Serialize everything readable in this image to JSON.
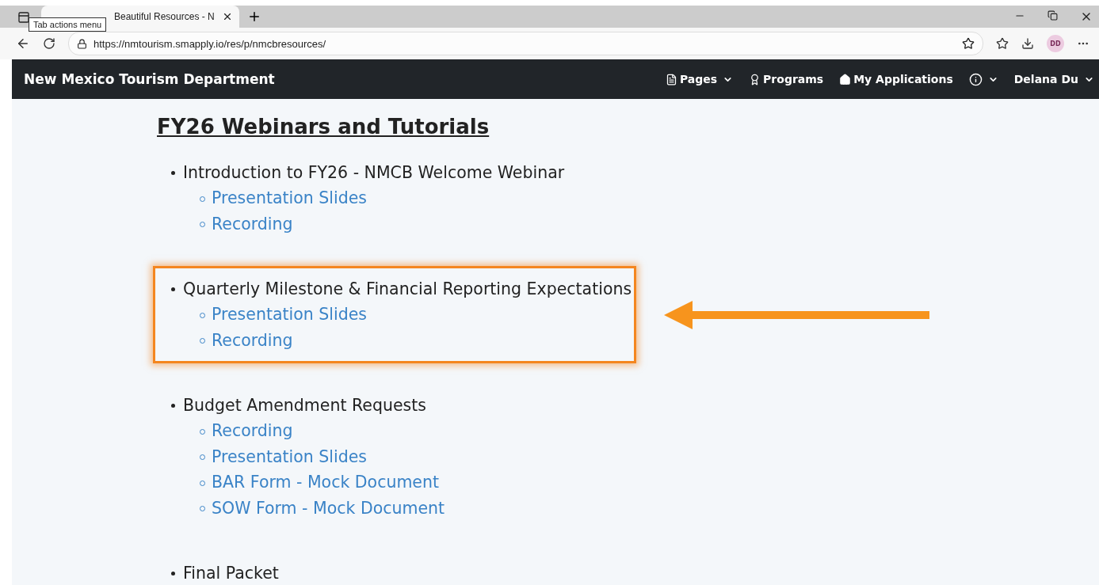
{
  "browser": {
    "tab_title": "Beautiful Resources - N",
    "tooltip": "Tab actions menu",
    "url": "https://nmtourism.smapply.io/res/p/nmcbresources/",
    "profile": "DD"
  },
  "navbar": {
    "brand": "New Mexico Tourism Department",
    "items": [
      {
        "label": "Pages",
        "dropdown": true
      },
      {
        "label": "Programs",
        "dropdown": false
      },
      {
        "label": "My Applications",
        "dropdown": false
      },
      {
        "dropdown": true
      },
      {
        "label": "Delana Du",
        "dropdown": true
      }
    ]
  },
  "heading": "FY26 Webinars and Tutorials",
  "sections": [
    {
      "title": "Introduction to FY26 - NMCB Welcome Webinar",
      "highlighted": false,
      "links": [
        "Presentation Slides",
        "Recording"
      ]
    },
    {
      "title": "Quarterly Milestone & Financial Reporting Expectations",
      "highlighted": true,
      "links": [
        "Presentation Slides",
        "Recording"
      ]
    },
    {
      "title": "Budget Amendment Requests",
      "highlighted": false,
      "links": [
        "Recording",
        "Presentation Slides",
        "BAR Form - Mock Document",
        "SOW Form - Mock Document"
      ]
    },
    {
      "title": "Final Packet",
      "highlighted": false
    }
  ]
}
